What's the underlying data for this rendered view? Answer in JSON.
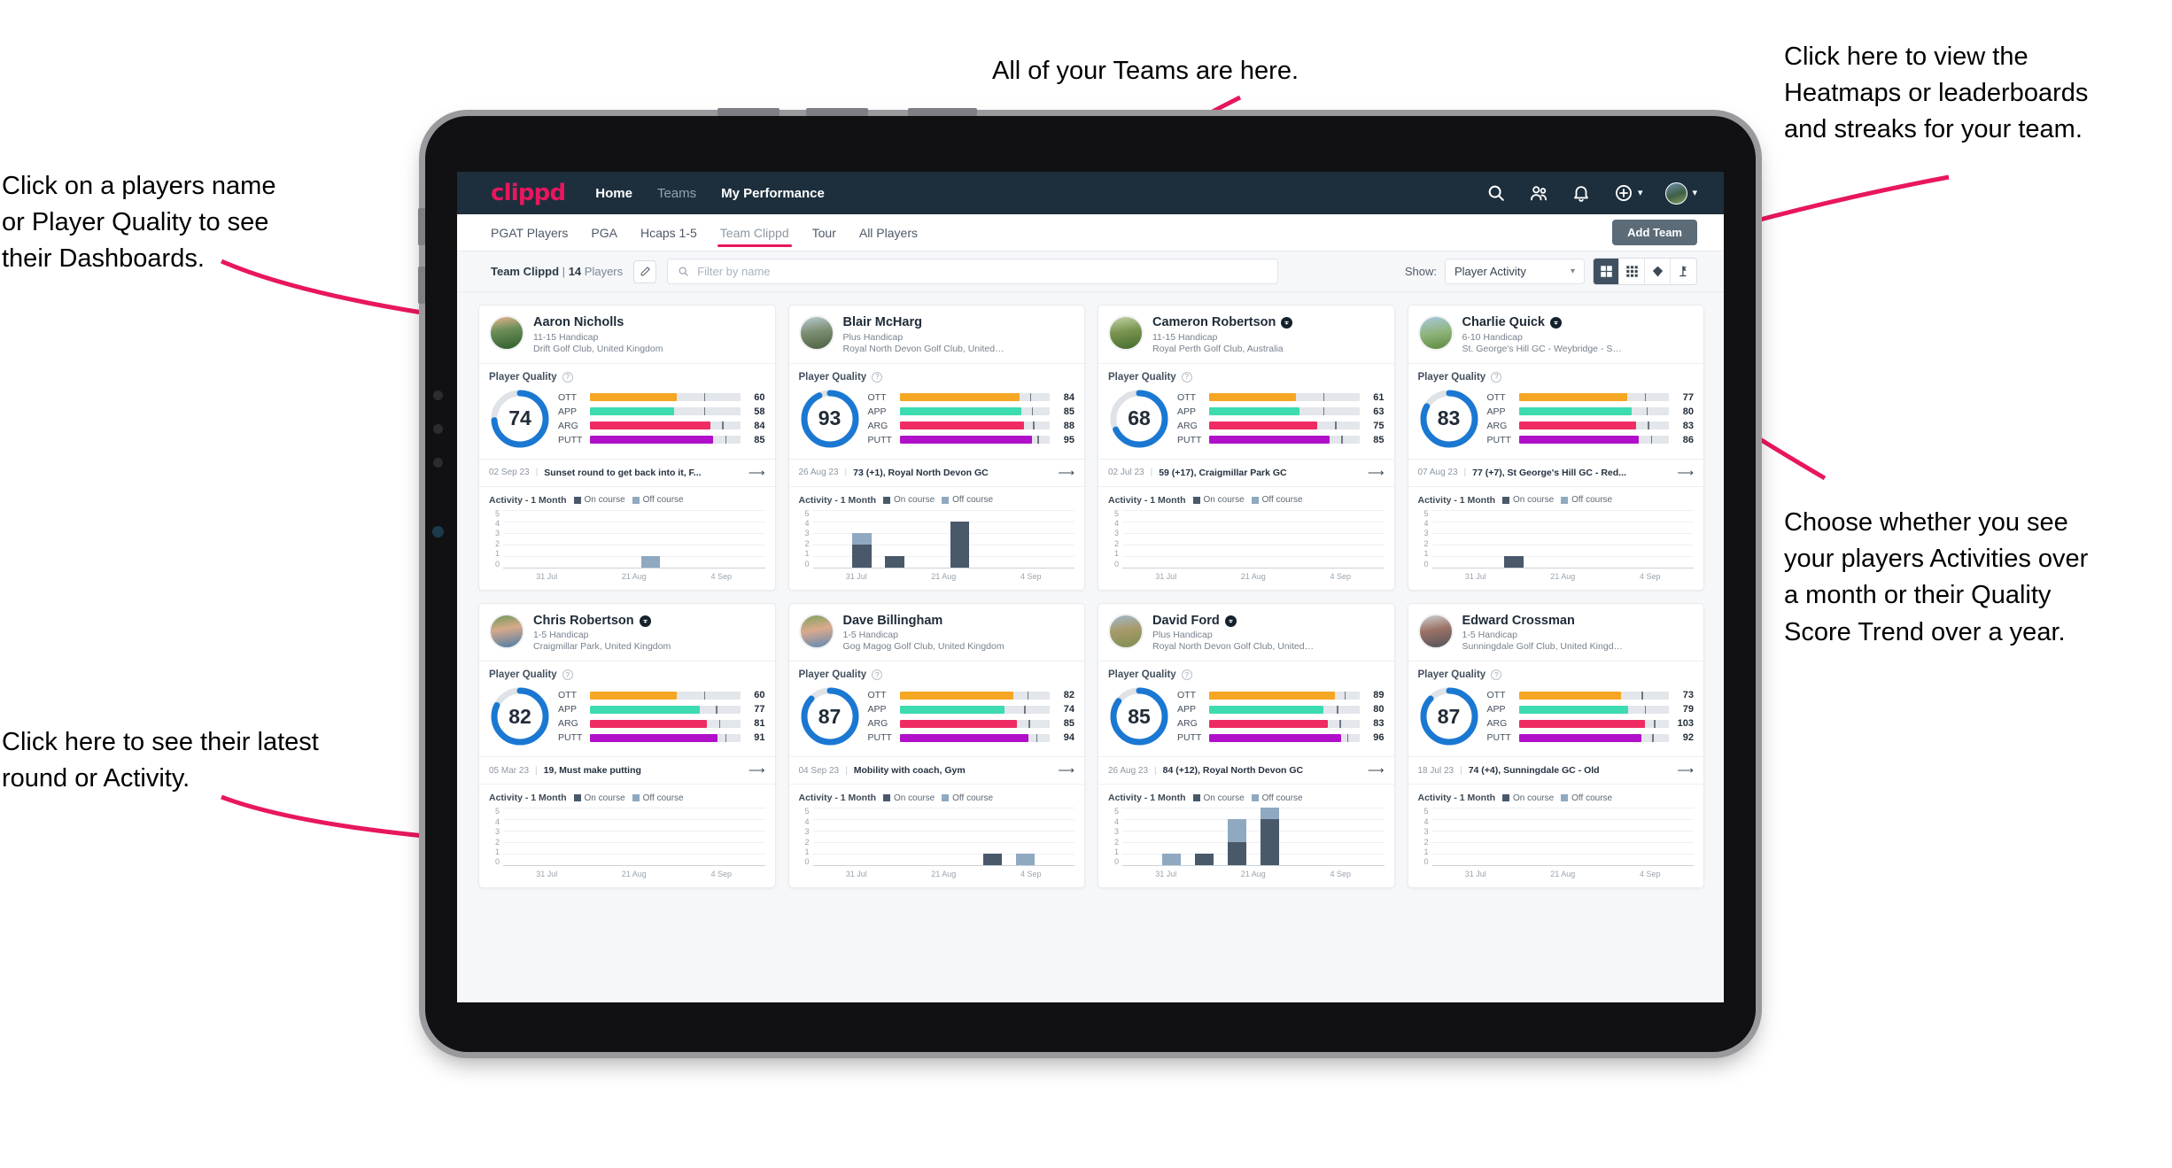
{
  "annotations": {
    "left_top": "Click on a players name\nor Player Quality to see\ntheir Dashboards.",
    "left_bottom": "Click here to see their latest\nround or Activity.",
    "top": "All of your Teams are here.",
    "right_top": "Click here to view the\nHeatmaps or leaderboards\nand streaks for your team.",
    "right_bottom": "Choose whether you see\nyour players Activities over\na month or their Quality\nScore Trend over a year."
  },
  "navbar": {
    "logo": "clippd",
    "links": [
      {
        "label": "Home",
        "muted": false
      },
      {
        "label": "Teams",
        "muted": true
      },
      {
        "label": "My Performance",
        "muted": false
      }
    ],
    "icons": [
      "search-icon",
      "people-icon",
      "bell-icon",
      "plus-circle-icon",
      "avatar"
    ]
  },
  "tabs": [
    {
      "label": "PGAT Players",
      "active": false
    },
    {
      "label": "PGA",
      "active": false
    },
    {
      "label": "Hcaps 1-5",
      "active": false
    },
    {
      "label": "Team Clippd",
      "active": true
    },
    {
      "label": "Tour",
      "active": false
    },
    {
      "label": "All Players",
      "active": false
    }
  ],
  "add_team_label": "Add Team",
  "filterbar": {
    "team_name": "Team Clippd",
    "separator": "|",
    "player_count": "14",
    "players_word": "Players",
    "edit_icon": "pencil-icon",
    "search_placeholder": "Filter by name",
    "search_value": "",
    "show_label": "Show:",
    "show_value": "Player Activity",
    "view_toggles": [
      {
        "name": "grid-large-view",
        "active": true
      },
      {
        "name": "grid-small-view",
        "active": false
      },
      {
        "name": "heatmap-view",
        "active": false
      },
      {
        "name": "leaderboard-view",
        "active": false
      }
    ]
  },
  "chart_common": {
    "activity_title": "Activity - 1 Month",
    "legend": [
      {
        "label": "On course",
        "color": "#49596a"
      },
      {
        "label": "Off course",
        "color": "#8fa9c0"
      }
    ],
    "yticks": [
      "5",
      "4",
      "3",
      "2",
      "1",
      "0"
    ],
    "xticks": [
      "31 Jul",
      "21 Aug",
      "4 Sep"
    ],
    "ymax": 5,
    "slots": 8
  },
  "bar_colors": {
    "OTT": "#f5a623",
    "APP": "#3ddbb0",
    "ARG": "#ef2b63",
    "PUTT": "#b010c9"
  },
  "quality_label": "Player Quality",
  "players": [
    {
      "name": "Aaron Nicholls",
      "verified": false,
      "handicap": "11-15 Handicap",
      "club": "Drift Golf Club, United Kingdom",
      "avatar": "linear-gradient(170deg,#e9b48e 0%,#6d8f5a 40%,#2f5c2a 100%)",
      "quality": 74,
      "metrics": [
        {
          "label": "OTT",
          "value": 60,
          "fill": 58,
          "tick": 76
        },
        {
          "label": "APP",
          "value": 58,
          "fill": 56,
          "tick": 76
        },
        {
          "label": "ARG",
          "value": 84,
          "fill": 80,
          "tick": 88
        },
        {
          "label": "PUTT",
          "value": 85,
          "fill": 82,
          "tick": 90
        }
      ],
      "latest": {
        "date": "02 Sep 23",
        "text": "Sunset round to get back into it, F..."
      },
      "chart_data": {
        "type": "bar",
        "title": "Activity - 1 Month",
        "categories": [
          "31 Jul",
          "",
          "",
          "21 Aug",
          "",
          "4 Sep",
          "",
          ""
        ],
        "series": [
          {
            "name": "On course",
            "values": [
              0,
              0,
              0,
              0,
              0,
              0,
              0,
              0
            ]
          },
          {
            "name": "Off course",
            "values": [
              0,
              0,
              0,
              0,
              1,
              0,
              0,
              0
            ]
          }
        ],
        "ylim": [
          0,
          5
        ]
      }
    },
    {
      "name": "Blair McHarg",
      "verified": false,
      "handicap": "Plus Handicap",
      "club": "Royal North Devon Golf Club, United Kin...",
      "avatar": "linear-gradient(170deg,#b9cbd6 0%,#7d8f72 45%,#4d6040 100%)",
      "quality": 93,
      "metrics": [
        {
          "label": "OTT",
          "value": 84,
          "fill": 80,
          "tick": 87
        },
        {
          "label": "APP",
          "value": 85,
          "fill": 81,
          "tick": 88
        },
        {
          "label": "ARG",
          "value": 88,
          "fill": 83,
          "tick": 89
        },
        {
          "label": "PUTT",
          "value": 95,
          "fill": 88,
          "tick": 92
        }
      ],
      "latest": {
        "date": "26 Aug 23",
        "text": "73 (+1), Royal North Devon GC"
      },
      "chart_data": {
        "type": "bar",
        "title": "Activity - 1 Month",
        "categories": [
          "31 Jul",
          "",
          "",
          "21 Aug",
          "",
          "4 Sep",
          "",
          ""
        ],
        "series": [
          {
            "name": "On course",
            "values": [
              0,
              2,
              1,
              0,
              4,
              0,
              0,
              0
            ]
          },
          {
            "name": "Off course",
            "values": [
              0,
              1,
              0,
              0,
              0,
              0,
              0,
              0
            ]
          }
        ],
        "ylim": [
          0,
          5
        ]
      }
    },
    {
      "name": "Cameron Robertson",
      "verified": true,
      "handicap": "11-15 Handicap",
      "club": "Royal Perth Golf Club, Australia",
      "avatar": "linear-gradient(170deg,#c4d4a8 0%,#79944f 45%,#456b2e 100%)",
      "quality": 68,
      "metrics": [
        {
          "label": "OTT",
          "value": 61,
          "fill": 58,
          "tick": 76
        },
        {
          "label": "APP",
          "value": 63,
          "fill": 60,
          "tick": 76
        },
        {
          "label": "ARG",
          "value": 75,
          "fill": 72,
          "tick": 84
        },
        {
          "label": "PUTT",
          "value": 85,
          "fill": 80,
          "tick": 88
        }
      ],
      "latest": {
        "date": "02 Jul 23",
        "text": "59 (+17), Craigmillar Park GC"
      },
      "chart_data": {
        "type": "bar",
        "title": "Activity - 1 Month",
        "categories": [
          "31 Jul",
          "",
          "",
          "21 Aug",
          "",
          "4 Sep",
          "",
          ""
        ],
        "series": [
          {
            "name": "On course",
            "values": [
              0,
              0,
              0,
              0,
              0,
              0,
              0,
              0
            ]
          },
          {
            "name": "Off course",
            "values": [
              0,
              0,
              0,
              0,
              0,
              0,
              0,
              0
            ]
          }
        ],
        "ylim": [
          0,
          5
        ]
      }
    },
    {
      "name": "Charlie Quick",
      "verified": true,
      "handicap": "6-10 Handicap",
      "club": "St. George's Hill GC - Weybridge - Surrey, ...",
      "avatar": "linear-gradient(170deg,#a8c8e0 0%,#8fb47a 50%,#5b8a3f 100%)",
      "quality": 83,
      "metrics": [
        {
          "label": "OTT",
          "value": 77,
          "fill": 72,
          "tick": 84
        },
        {
          "label": "APP",
          "value": 80,
          "fill": 75,
          "tick": 85
        },
        {
          "label": "ARG",
          "value": 83,
          "fill": 78,
          "tick": 86
        },
        {
          "label": "PUTT",
          "value": 86,
          "fill": 80,
          "tick": 88
        }
      ],
      "latest": {
        "date": "07 Aug 23",
        "text": "77 (+7), St George's Hill GC - Red..."
      },
      "chart_data": {
        "type": "bar",
        "title": "Activity - 1 Month",
        "categories": [
          "31 Jul",
          "",
          "",
          "21 Aug",
          "",
          "4 Sep",
          "",
          ""
        ],
        "series": [
          {
            "name": "On course",
            "values": [
              0,
              0,
              1,
              0,
              0,
              0,
              0,
              0
            ]
          },
          {
            "name": "Off course",
            "values": [
              0,
              0,
              0,
              0,
              0,
              0,
              0,
              0
            ]
          }
        ],
        "ylim": [
          0,
          5
        ]
      }
    },
    {
      "name": "Chris Robertson",
      "verified": true,
      "handicap": "1-5 Handicap",
      "club": "Craigmillar Park, United Kingdom",
      "avatar": "linear-gradient(170deg,#6f9a5a 0%,#d7a98a 42%,#4a7ba8 100%)",
      "quality": 82,
      "metrics": [
        {
          "label": "OTT",
          "value": 60,
          "fill": 58,
          "tick": 76
        },
        {
          "label": "APP",
          "value": 77,
          "fill": 73,
          "tick": 84
        },
        {
          "label": "ARG",
          "value": 81,
          "fill": 78,
          "tick": 86
        },
        {
          "label": "PUTT",
          "value": 91,
          "fill": 85,
          "tick": 90
        }
      ],
      "latest": {
        "date": "05 Mar 23",
        "text": "19, Must make putting"
      },
      "chart_data": {
        "type": "bar",
        "title": "Activity - 1 Month",
        "categories": [
          "31 Jul",
          "",
          "",
          "21 Aug",
          "",
          "4 Sep",
          "",
          ""
        ],
        "series": [
          {
            "name": "On course",
            "values": [
              0,
              0,
              0,
              0,
              0,
              0,
              0,
              0
            ]
          },
          {
            "name": "Off course",
            "values": [
              0,
              0,
              0,
              0,
              0,
              0,
              0,
              0
            ]
          }
        ],
        "ylim": [
          0,
          5
        ]
      }
    },
    {
      "name": "Dave Billingham",
      "verified": false,
      "handicap": "1-5 Handicap",
      "club": "Gog Magog Golf Club, United Kingdom",
      "avatar": "linear-gradient(170deg,#7fa35f 0%,#dba98c 45%,#5d89b3 100%)",
      "quality": 87,
      "metrics": [
        {
          "label": "OTT",
          "value": 82,
          "fill": 76,
          "tick": 85
        },
        {
          "label": "APP",
          "value": 74,
          "fill": 70,
          "tick": 83
        },
        {
          "label": "ARG",
          "value": 85,
          "fill": 78,
          "tick": 86
        },
        {
          "label": "PUTT",
          "value": 94,
          "fill": 86,
          "tick": 91
        }
      ],
      "latest": {
        "date": "04 Sep 23",
        "text": "Mobility with coach, Gym"
      },
      "chart_data": {
        "type": "bar",
        "title": "Activity - 1 Month",
        "categories": [
          "31 Jul",
          "",
          "",
          "21 Aug",
          "",
          "4 Sep",
          "",
          ""
        ],
        "series": [
          {
            "name": "On course",
            "values": [
              0,
              0,
              0,
              0,
              0,
              1,
              0,
              0
            ]
          },
          {
            "name": "Off course",
            "values": [
              0,
              0,
              0,
              0,
              0,
              0,
              1,
              0
            ]
          }
        ],
        "ylim": [
          0,
          5
        ]
      }
    },
    {
      "name": "David Ford",
      "verified": true,
      "handicap": "Plus Handicap",
      "club": "Royal North Devon Golf Club, United Kin...",
      "avatar": "linear-gradient(170deg,#9fb9cf 0%,#a89a6a 45%,#7d8e52 100%)",
      "quality": 85,
      "metrics": [
        {
          "label": "OTT",
          "value": 89,
          "fill": 84,
          "tick": 90
        },
        {
          "label": "APP",
          "value": 80,
          "fill": 76,
          "tick": 85
        },
        {
          "label": "ARG",
          "value": 83,
          "fill": 79,
          "tick": 87
        },
        {
          "label": "PUTT",
          "value": 96,
          "fill": 88,
          "tick": 92
        }
      ],
      "latest": {
        "date": "26 Aug 23",
        "text": "84 (+12), Royal North Devon GC"
      },
      "chart_data": {
        "type": "bar",
        "title": "Activity - 1 Month",
        "categories": [
          "31 Jul",
          "",
          "",
          "21 Aug",
          "",
          "4 Sep",
          "",
          ""
        ],
        "series": [
          {
            "name": "On course",
            "values": [
              0,
              0,
              1,
              2,
              4,
              0,
              0,
              0
            ]
          },
          {
            "name": "Off course",
            "values": [
              0,
              1,
              0,
              2,
              1,
              0,
              0,
              0
            ]
          }
        ],
        "ylim": [
          0,
          5
        ]
      }
    },
    {
      "name": "Edward Crossman",
      "verified": false,
      "handicap": "1-5 Handicap",
      "club": "Sunningdale Golf Club, United Kingdom",
      "avatar": "linear-gradient(170deg,#cfcfd3 0%,#9b7266 45%,#55545a 100%)",
      "quality": 87,
      "metrics": [
        {
          "label": "OTT",
          "value": 73,
          "fill": 68,
          "tick": 82
        },
        {
          "label": "APP",
          "value": 79,
          "fill": 73,
          "tick": 84
        },
        {
          "label": "ARG",
          "value": 103,
          "fill": 84,
          "tick": 90
        },
        {
          "label": "PUTT",
          "value": 92,
          "fill": 82,
          "tick": 89
        }
      ],
      "latest": {
        "date": "18 Jul 23",
        "text": "74 (+4), Sunningdale GC - Old"
      },
      "chart_data": {
        "type": "bar",
        "title": "Activity - 1 Month",
        "categories": [
          "31 Jul",
          "",
          "",
          "21 Aug",
          "",
          "4 Sep",
          "",
          ""
        ],
        "series": [
          {
            "name": "On course",
            "values": [
              0,
              0,
              0,
              0,
              0,
              0,
              0,
              0
            ]
          },
          {
            "name": "Off course",
            "values": [
              0,
              0,
              0,
              0,
              0,
              0,
              0,
              0
            ]
          }
        ],
        "ylim": [
          0,
          5
        ]
      }
    }
  ]
}
